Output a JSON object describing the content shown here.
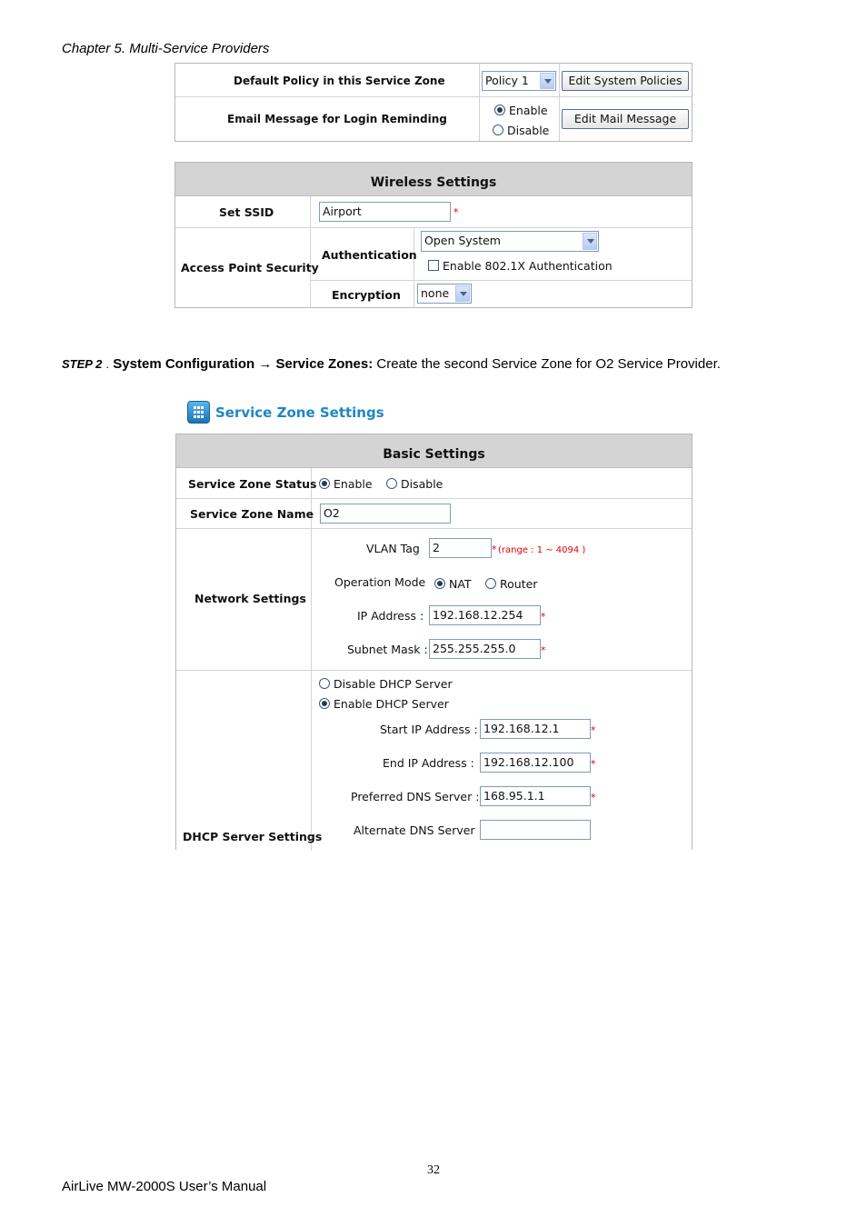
{
  "header": {
    "chapter": "Chapter 5. Multi-Service Providers"
  },
  "policy_table": {
    "default_policy_label": "Default Policy in this Service Zone",
    "policy_select": "Policy 1",
    "edit_policies_button": "Edit System Policies",
    "email_label": "Email Message for Login Reminding",
    "enable_label": "Enable",
    "disable_label": "Disable",
    "edit_mail_button": "Edit Mail Message"
  },
  "wireless": {
    "title": "Wireless Settings",
    "ssid_label": "Set SSID",
    "ssid_value": "Airport",
    "ap_security_label": "Access Point Security",
    "authentication_label": "Authentication",
    "authentication_value": "Open System",
    "dot1x_label": "Enable 802.1X Authentication",
    "encryption_label": "Encryption",
    "encryption_value": "none",
    "required_mark": "*"
  },
  "step": {
    "step_label": "STEP 2",
    "sep": ".",
    "path_a": "System Configuration",
    "arrow": "→",
    "path_b": "Service Zones:",
    "text": " Create the second Service Zone for O2 Service Provider."
  },
  "service_zone": {
    "title": "Service Zone Settings",
    "basic_title": "Basic Settings",
    "status_label": "Service Zone Status",
    "status_enable": "Enable",
    "status_disable": "Disable",
    "name_label": "Service Zone Name",
    "name_value": "O2",
    "network_label": "Network Settings",
    "vlan_label": "VLAN Tag",
    "vlan_value": "2",
    "vlan_range": "(range : 1 ~ 4094 )",
    "op_mode_label": "Operation Mode",
    "op_nat": "NAT",
    "op_router": "Router",
    "ip_label": "IP Address :",
    "ip_value": "192.168.12.254",
    "mask_label": "Subnet Mask :",
    "mask_value": "255.255.255.0",
    "dhcp_label": "DHCP Server Settings",
    "dhcp_disable": "Disable DHCP Server",
    "dhcp_enable": "Enable DHCP Server",
    "start_ip_label": "Start IP Address :",
    "start_ip_value": "192.168.12.1",
    "end_ip_label": "End IP Address :",
    "end_ip_value": "192.168.12.100",
    "pref_dns_label": "Preferred DNS Server :",
    "pref_dns_value": "168.95.1.1",
    "alt_dns_label": "Alternate DNS Server :",
    "alt_dns_value": "",
    "required_mark": "*"
  },
  "footer": {
    "page_number": "32",
    "manual": "AirLive MW-2000S User’s Manual"
  }
}
